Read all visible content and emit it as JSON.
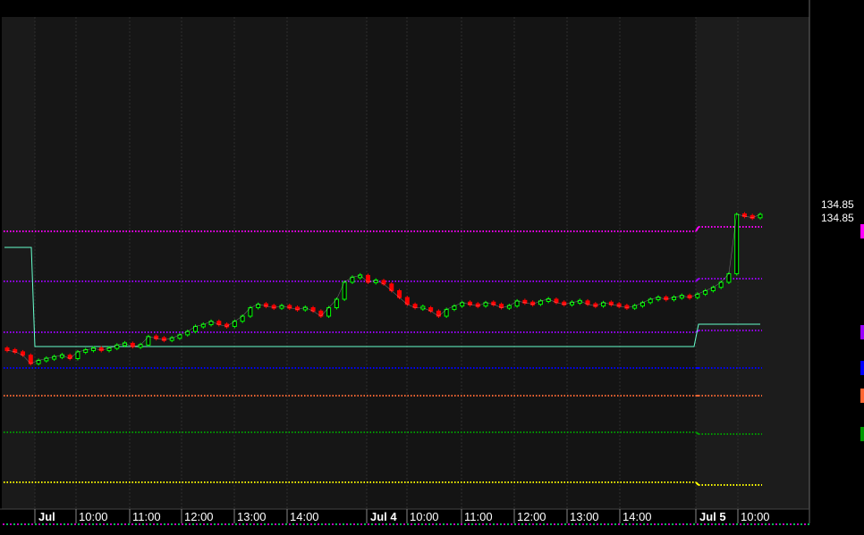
{
  "chart_data": {
    "type": "candlestick",
    "x_ticks": [
      {
        "label": "Jul",
        "bold": true
      },
      {
        "label": "10:00",
        "bold": false
      },
      {
        "label": "11:00",
        "bold": false
      },
      {
        "label": "12:00",
        "bold": false
      },
      {
        "label": "13:00",
        "bold": false
      },
      {
        "label": "14:00",
        "bold": false
      },
      {
        "label": "Jul 4",
        "bold": true
      },
      {
        "label": "10:00",
        "bold": false
      },
      {
        "label": "11:00",
        "bold": false
      },
      {
        "label": "12:00",
        "bold": false
      },
      {
        "label": "13:00",
        "bold": false
      },
      {
        "label": "14:00",
        "bold": false
      },
      {
        "label": "Jul 5",
        "bold": true
      },
      {
        "label": "10:00",
        "bold": false
      }
    ],
    "ylim": [
      133.4,
      135.2
    ],
    "last_price_labels": [
      "134.85",
      "134.85"
    ],
    "closes": [
      134.05,
      134.04,
      134.02,
      133.97,
      133.99,
      134.0,
      134.01,
      134.02,
      134.0,
      134.04,
      134.05,
      134.06,
      134.05,
      134.06,
      134.08,
      134.09,
      134.07,
      134.08,
      134.13,
      134.12,
      134.11,
      134.12,
      134.14,
      134.16,
      134.19,
      134.2,
      134.22,
      134.2,
      134.19,
      134.22,
      134.25,
      134.3,
      134.32,
      134.31,
      134.3,
      134.31,
      134.3,
      134.29,
      134.3,
      134.28,
      134.25,
      134.3,
      134.35,
      134.45,
      134.48,
      134.49,
      134.45,
      134.46,
      134.44,
      134.4,
      134.36,
      134.32,
      134.3,
      134.3,
      134.28,
      134.25,
      134.29,
      134.31,
      134.33,
      134.32,
      134.31,
      134.33,
      134.32,
      134.3,
      134.31,
      134.34,
      134.33,
      134.32,
      134.34,
      134.35,
      134.33,
      134.32,
      134.33,
      134.34,
      134.32,
      134.31,
      134.33,
      134.32,
      134.31,
      134.3,
      134.31,
      134.33,
      134.35,
      134.36,
      134.35,
      134.36,
      134.37,
      134.36,
      134.38,
      134.4,
      134.42,
      134.45,
      134.5,
      134.85,
      134.84,
      134.83,
      134.85
    ],
    "up_color": "#00ff00",
    "down_color": "#ff0000",
    "price_color": "#ffffff",
    "series": [
      {
        "color": "#ff00ff",
        "segments": [
          [
            134.75,
            134.75
          ],
          [
            134.8,
            134.8
          ]
        ]
      },
      {
        "color": "#9900ff",
        "segments": [
          [
            134.12,
            134.12
          ],
          [
            134.12,
            134.12
          ]
        ]
      },
      {
        "color": "#9900ff",
        "segments": [
          [
            133.82,
            133.82
          ],
          [
            133.82,
            133.82
          ]
        ]
      },
      {
        "color": "#0000ff",
        "segments": [
          [
            133.55,
            133.55
          ],
          [
            133.55,
            133.55
          ]
        ]
      },
      {
        "color": "#ff6633",
        "segments": [
          [
            133.3,
            133.3
          ],
          [
            133.3,
            133.3
          ]
        ]
      },
      {
        "color": "#009900",
        "segments": [
          [
            132.85,
            132.85
          ],
          [
            132.84,
            132.84
          ]
        ]
      },
      {
        "color": "#ffff00",
        "segments": [
          [
            132.35,
            132.35
          ],
          [
            132.33,
            132.33
          ]
        ]
      }
    ],
    "step_line": {
      "color": "#66ffcc",
      "values": [
        134.55,
        133.75,
        133.75,
        134.0
      ]
    },
    "legend_marker_colors": [
      "#ff00ff",
      "#9900ff",
      "#0000ff",
      "#ff6633",
      "#009900"
    ]
  }
}
